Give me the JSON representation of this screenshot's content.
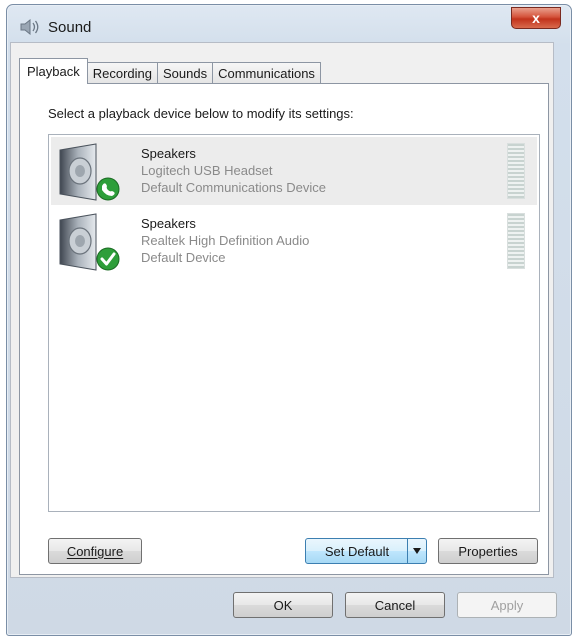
{
  "window": {
    "title": "Sound",
    "close_label": "x"
  },
  "tabs": [
    {
      "label": "Playback",
      "active": true
    },
    {
      "label": "Recording",
      "active": false
    },
    {
      "label": "Sounds",
      "active": false
    },
    {
      "label": "Communications",
      "active": false
    }
  ],
  "playback": {
    "instruction": "Select a playback device below to modify its settings:",
    "devices": [
      {
        "name": "Speakers",
        "description": "Logitech USB Headset",
        "status": "Default Communications Device",
        "status_icon": "phone-badge-icon",
        "selected": true
      },
      {
        "name": "Speakers",
        "description": "Realtek High Definition Audio",
        "status": "Default Device",
        "status_icon": "checkmark-badge-icon",
        "selected": false
      }
    ],
    "configure_label": "Configure",
    "set_default_label": "Set Default",
    "properties_label": "Properties"
  },
  "footer": {
    "ok_label": "OK",
    "cancel_label": "Cancel",
    "apply_label": "Apply"
  },
  "colors": {
    "badge_green": "#2e9e3a",
    "focus_blue": "#3c7fb1",
    "close_red": "#c2331c"
  }
}
